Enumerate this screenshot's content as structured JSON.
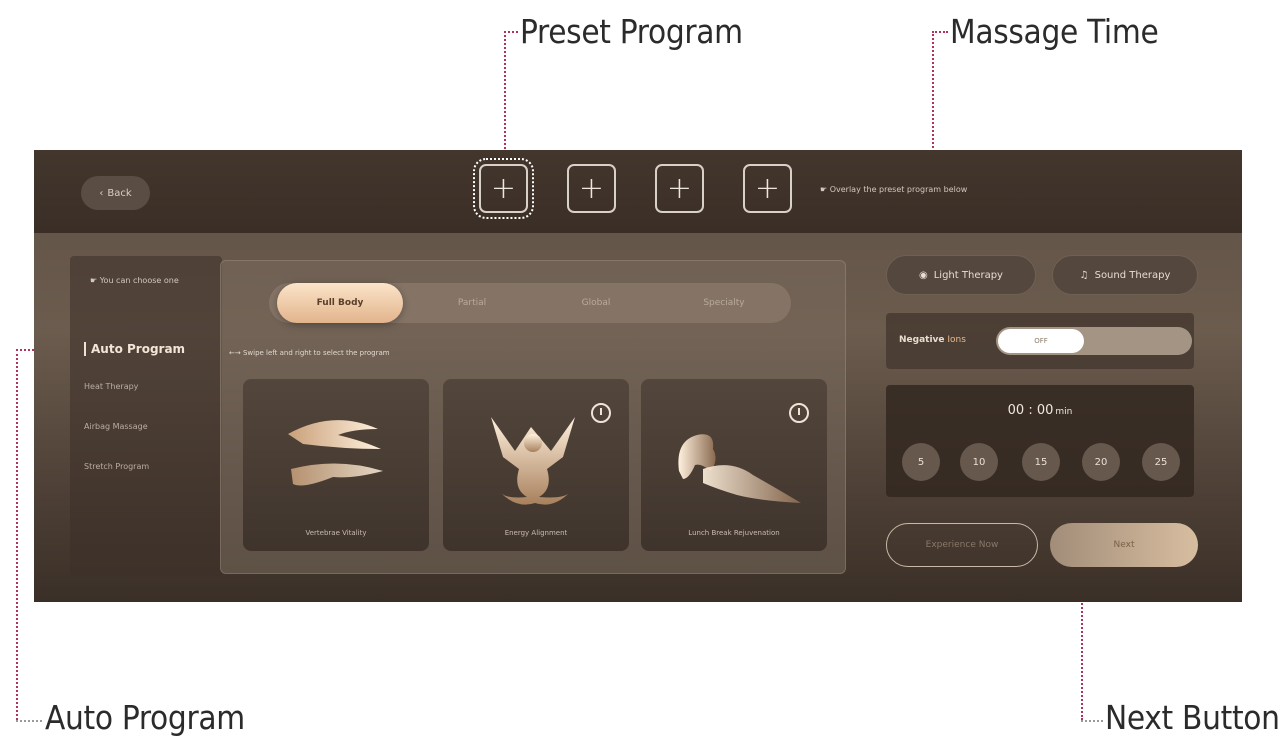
{
  "callouts": {
    "preset_program": "Preset Program",
    "massage_time": "Massage Time",
    "auto_program": "Auto Program",
    "next_button": "Next Button"
  },
  "topbar": {
    "back_label": "Back",
    "preset_slots": [
      "+",
      "+",
      "+",
      "+"
    ],
    "overlay_hint": "Overlay the preset program below"
  },
  "sidebar": {
    "hint": "You can choose one",
    "items": [
      {
        "label": "Auto Program",
        "active": true
      },
      {
        "label": "Heat Therapy"
      },
      {
        "label": "Airbag Massage"
      },
      {
        "label": "Stretch Program"
      }
    ]
  },
  "content": {
    "tabs": [
      {
        "label": "Full Body",
        "active": true
      },
      {
        "label": "Partial"
      },
      {
        "label": "Global"
      },
      {
        "label": "Specialty"
      }
    ],
    "swipe_hint": "Swipe left and right to select the program",
    "cards": [
      {
        "label": "Vertebrae Vitality",
        "icon": "hands-icon"
      },
      {
        "label": "Energy Alignment",
        "icon": "stretch-figure-icon"
      },
      {
        "label": "Lunch Break Rejuvenation",
        "icon": "resting-figure-icon"
      }
    ]
  },
  "right_panel": {
    "light_therapy": "Light Therapy",
    "sound_therapy": "Sound Therapy",
    "negative_ions_prefix": "Negative",
    "negative_ions_suffix": "Ions",
    "toggle_state": "OFF",
    "time": "00 : 00",
    "time_unit": "min",
    "durations": [
      "5",
      "10",
      "15",
      "20",
      "25"
    ],
    "experience_now": "Experience Now",
    "next": "Next"
  },
  "colors": {
    "accent": "#e7b98c",
    "annotation_line": "#b0345a"
  }
}
